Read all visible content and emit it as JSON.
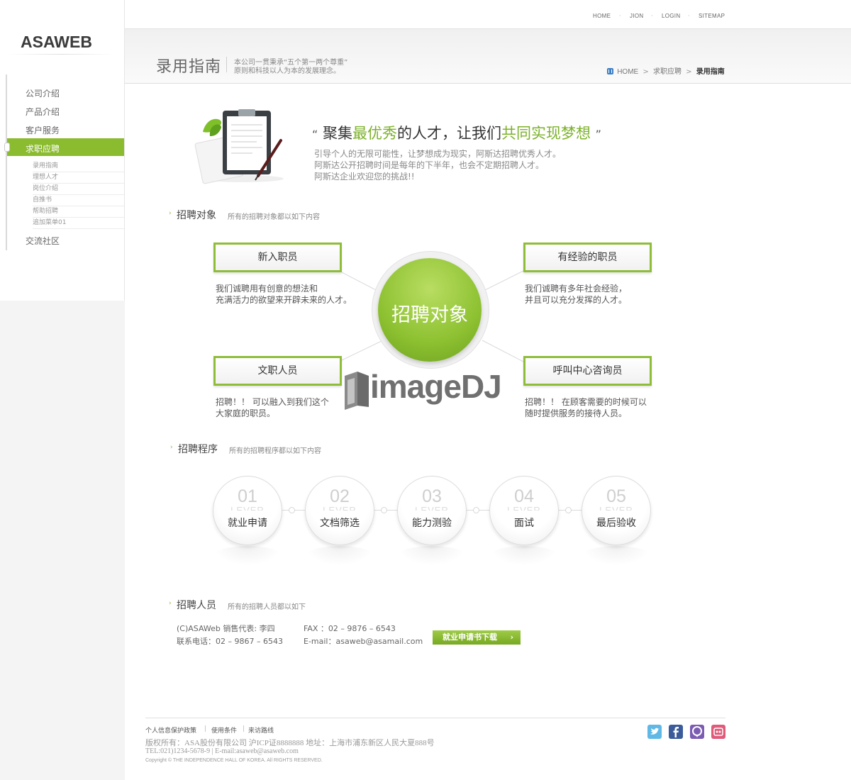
{
  "logo": "ASAWEB",
  "top_nav": [
    "HOME",
    "JION",
    "LOGIN",
    "SITEMAP"
  ],
  "sidebar": {
    "items": [
      "公司介绍",
      "产品介绍",
      "客户服务",
      "求职应聘",
      "交流社区"
    ],
    "active": "求职应聘",
    "sub_items": [
      "录用指南",
      "理想人才",
      "岗位介绍",
      "自推书",
      "帮助招聘",
      "追加菜单01"
    ]
  },
  "header": {
    "title": "录用指南",
    "desc_line1": "本公司一贯秉承“五个第一两个尊重”",
    "desc_line2": "原则和科技以人为本的发展理念。",
    "breadcrumb": {
      "home": "HOME",
      "level1": "求职应聘",
      "level2": "录用指南"
    }
  },
  "intro": {
    "quote_open": "“",
    "slogan_a": "聚集",
    "slogan_b": "最优秀",
    "slogan_c": "的人才，让我们",
    "slogan_d": "共同实现梦想",
    "quote_close": "”",
    "line1": "引导个人的无限可能性，让梦想成为现实，阿斯达招聘优秀人才。",
    "line2": "阿斯达公开招聘时间是每年的下半年，也会不定期招聘人才。",
    "line3": "阿斯达企业欢迎您的挑战!!"
  },
  "sections": {
    "targets": {
      "title": "招聘对象",
      "desc": "所有的招聘对象都以如下内容"
    },
    "process": {
      "title": "招聘程序",
      "desc": "所有的招聘程序都以如下内容"
    },
    "staff": {
      "title": "招聘人员",
      "desc": "所有的招聘人员都以如下"
    }
  },
  "targets": {
    "center": "招聘对象",
    "items": [
      {
        "title": "新入职员",
        "desc1": "我们诚聘用有创意的想法和",
        "desc2": "充满活力的欲望来开辟未来的人才。"
      },
      {
        "title": "有经验的职员",
        "desc1": "我们诚聘有多年社会经验，",
        "desc2": "并且可以充分发挥的人才。"
      },
      {
        "title": "文职人员",
        "desc1": "招聘！！ 可以融入到我们这个",
        "desc2": "大家庭的职员。"
      },
      {
        "title": "呼叫中心咨询员",
        "desc1": "招聘！！ 在顾客需要的时候可以",
        "desc2": "随时提供服务的接待人员。"
      }
    ]
  },
  "watermark": "imageDJ",
  "steps": [
    {
      "num": "01",
      "lever": "LEVER",
      "label": "就业申请"
    },
    {
      "num": "02",
      "lever": "LEVER",
      "label": "文档筛选"
    },
    {
      "num": "03",
      "lever": "LEVER",
      "label": "能力测验"
    },
    {
      "num": "04",
      "lever": "LEVER",
      "label": "面试"
    },
    {
      "num": "05",
      "lever": "LEVER",
      "label": "最后验收"
    }
  ],
  "contact": {
    "rep": "(C)ASAWeb 销售代表:  李四",
    "phone": "联系电话：02 – 9867 – 6543",
    "fax": "FAX ：02 – 9876 – 6543",
    "email": "E-mail：asaweb@asamail.com",
    "download": "就业申请书下载"
  },
  "footer": {
    "links": [
      "个人信息保护政策",
      "使用条件",
      "来访路线"
    ],
    "line1": "版权所有：ASA股份有限公司 沪ICP证8888888 地址：上海市浦东新区人民大夏888号",
    "line2": "TEL:021)1234-5678-9 | E-mail:asaweb@asaweb.com",
    "copyright": "Copyright © THE INDEPENDENCE HALL OF KOREA. All RIGHTS RESERVED."
  },
  "social_icons": [
    "twitter-icon",
    "facebook-icon",
    "messenger-icon",
    "rss-icon"
  ],
  "colors": {
    "accent": "#8bbb2f",
    "accent_text": "#7cb129"
  }
}
